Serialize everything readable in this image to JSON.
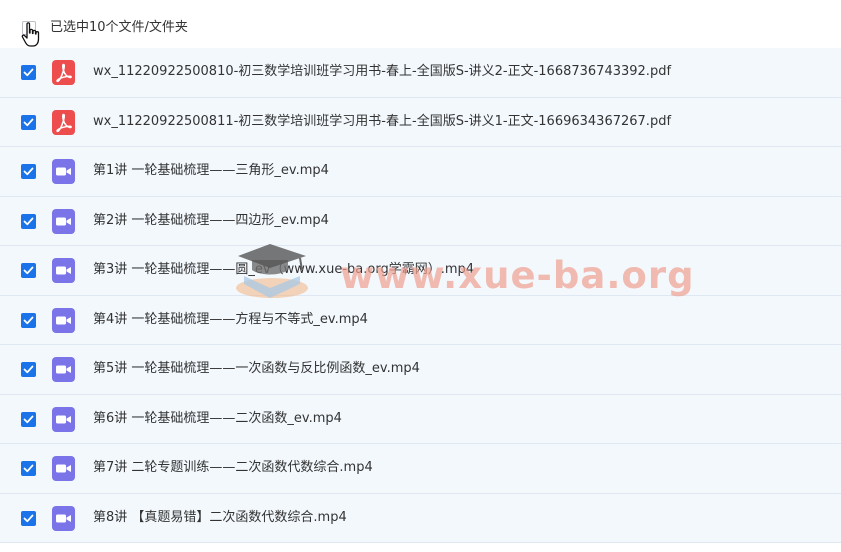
{
  "header": {
    "selection_label": "已选中10个文件/文件夹"
  },
  "files": [
    {
      "name": "wx_11220922500810-初三数学培训班学习用书-春上-全国版S-讲义2-正文-1668736743392.pdf",
      "type": "pdf",
      "icon": "pdf-icon"
    },
    {
      "name": "wx_11220922500811-初三数学培训班学习用书-春上-全国版S-讲义1-正文-1669634367267.pdf",
      "type": "pdf",
      "icon": "pdf-icon"
    },
    {
      "name": "第1讲 一轮基础梳理——三角形_ev.mp4",
      "type": "video",
      "icon": "video-icon"
    },
    {
      "name": "第2讲 一轮基础梳理——四边形_ev.mp4",
      "type": "video",
      "icon": "video-icon"
    },
    {
      "name": "第3讲 一轮基础梳理——圆_ev（www.xue-ba.org学霸网）.mp4",
      "type": "video",
      "icon": "video-icon"
    },
    {
      "name": "第4讲 一轮基础梳理——方程与不等式_ev.mp4",
      "type": "video",
      "icon": "video-icon"
    },
    {
      "name": "第5讲 一轮基础梳理——一次函数与反比例函数_ev.mp4",
      "type": "video",
      "icon": "video-icon"
    },
    {
      "name": "第6讲 一轮基础梳理——二次函数_ev.mp4",
      "type": "video",
      "icon": "video-icon"
    },
    {
      "name": "第7讲 二轮专题训练——二次函数代数综合.mp4",
      "type": "video",
      "icon": "video-icon"
    },
    {
      "name": "第8讲 【真题易错】二次函数代数综合.mp4",
      "type": "video",
      "icon": "video-icon"
    }
  ],
  "watermark": {
    "text": "www.xue-ba.org"
  },
  "colors": {
    "checkbox": "#1a73e8",
    "pdf": "#ee4d4d",
    "video": "#7b73e8",
    "row_bg": "#f3f8fd"
  }
}
